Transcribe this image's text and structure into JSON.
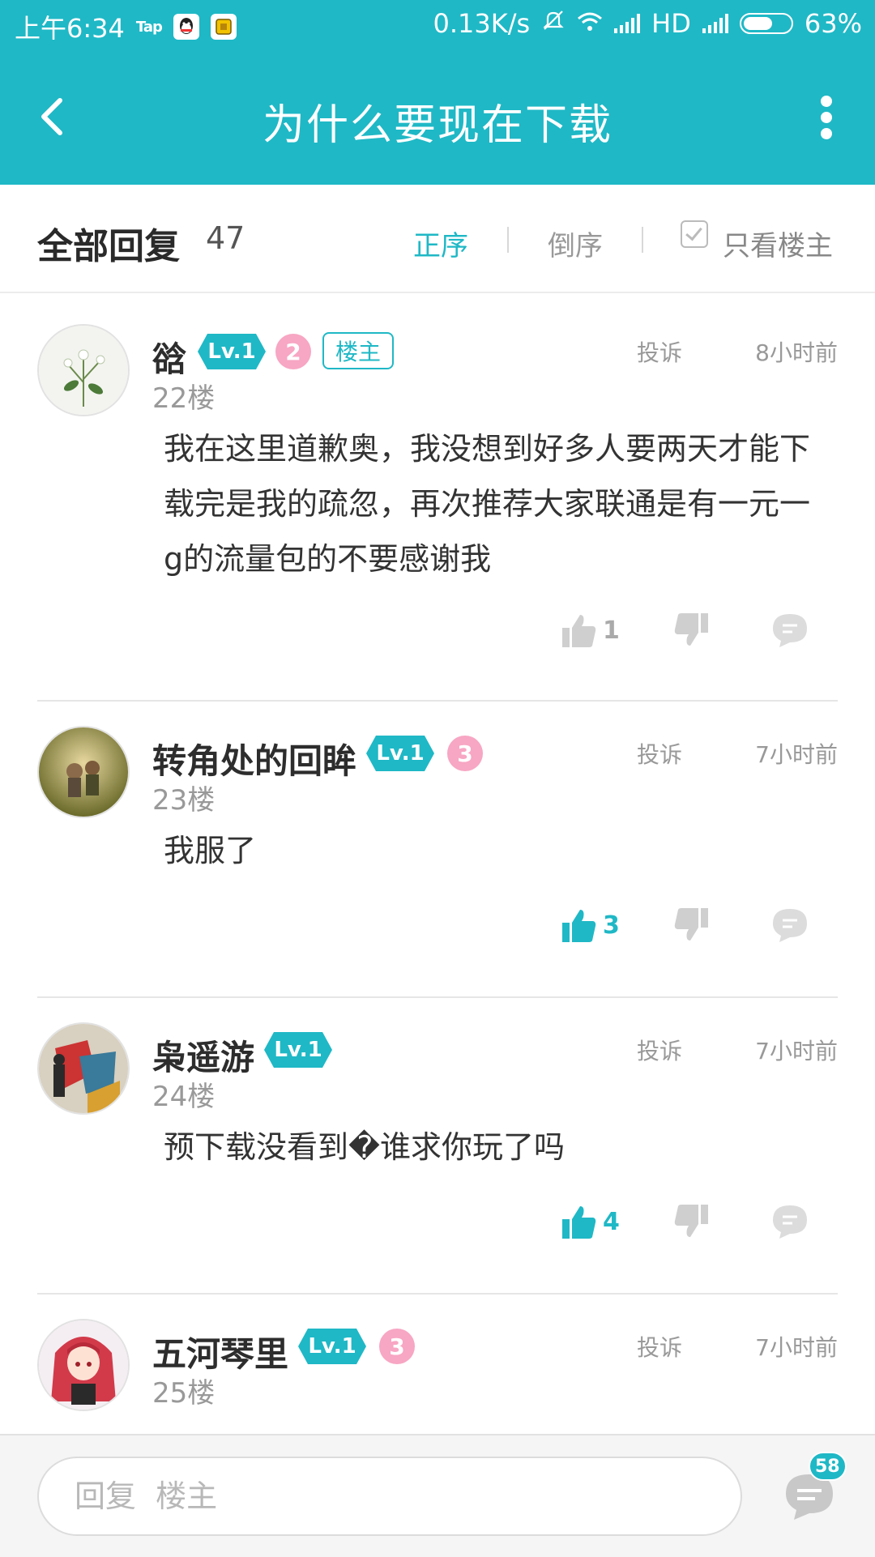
{
  "status_bar": {
    "time": "上午6:34",
    "tap_label": "Tap",
    "net_speed": "0.13K/s",
    "hd_label": "HD",
    "battery": "63%",
    "battery_level": 0.63
  },
  "app_bar": {
    "title": "为什么要现在下载"
  },
  "reply_header": {
    "title": "全部回复",
    "count": "47",
    "sort_asc": "正序",
    "sort_desc": "倒序",
    "only_owner": "只看楼主"
  },
  "colors": {
    "accent": "#1fb8c6",
    "pink_medal": "#f7a6c3",
    "inactive_icon": "#cfcfcf"
  },
  "posts": [
    {
      "username": "谽",
      "level": "Lv.1",
      "medal": "2",
      "owner_tag": "楼主",
      "floor": "22楼",
      "report": "投诉",
      "time": "8小时前",
      "content": "我在这里道歉奥，我没想到好多人要两天才能下载完是我的疏忽，再次推荐大家联通是有一元一g的流量包的不要感谢我",
      "likes": "1",
      "liked": false
    },
    {
      "username": "转角处的回眸",
      "level": "Lv.1",
      "medal": "3",
      "floor": "23楼",
      "report": "投诉",
      "time": "7小时前",
      "content": "我服了",
      "likes": "3",
      "liked": true
    },
    {
      "username": "枭遥游",
      "level": "Lv.1",
      "floor": "24楼",
      "report": "投诉",
      "time": "7小时前",
      "content": "预下载没看到�谁求你玩了吗",
      "likes": "4",
      "liked": true
    },
    {
      "username": "五河琴里",
      "level": "Lv.1",
      "medal": "3",
      "floor": "25楼",
      "report": "投诉",
      "time": "7小时前",
      "content": "",
      "likes": "",
      "liked": false
    }
  ],
  "bottom_bar": {
    "reply_placeholder": "回复  楼主",
    "comment_count": "58"
  }
}
